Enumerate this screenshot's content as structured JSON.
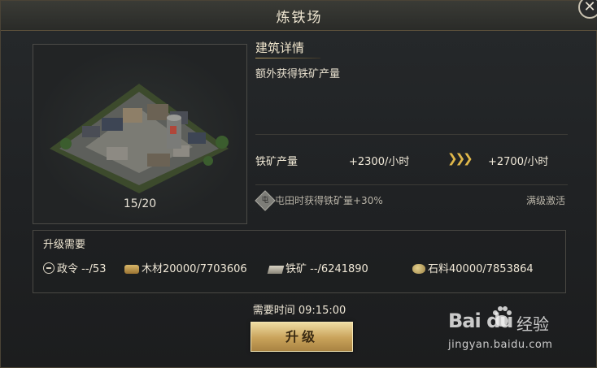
{
  "window": {
    "title": "炼铁场",
    "close_glyph": "✕"
  },
  "building": {
    "level": "15/20"
  },
  "details": {
    "section_title": "建筑详情",
    "description": "额外获得铁矿产量",
    "stat": {
      "label": "铁矿产量",
      "current": "+2300/小时",
      "arrows": "❯❯❯",
      "next": "+2700/小时"
    },
    "bonus": {
      "icon": "屯",
      "text": "屯田时获得铁矿量+30%",
      "note": "满级激活"
    }
  },
  "requirements": {
    "title": "升级需要",
    "items": [
      {
        "icon": "decree-icon",
        "label": "政令",
        "value": "--/53"
      },
      {
        "icon": "wood-icon",
        "label": "木材",
        "value": "20000/7703606"
      },
      {
        "icon": "iron-icon",
        "label": "铁矿",
        "value": "--/6241890"
      },
      {
        "icon": "stone-icon",
        "label": "石料",
        "value": "40000/7853864"
      }
    ]
  },
  "upgrade": {
    "time_label": "需要时间",
    "time_value": "09:15:00",
    "button_label": "升级"
  },
  "watermark": {
    "logo": "Bai du",
    "cn": "经验",
    "url": "jingyan.baidu.com"
  },
  "colors": {
    "accent_gold": "#e0b84a",
    "button_gold": "#c9a25a",
    "text_light": "#efe7d6"
  }
}
